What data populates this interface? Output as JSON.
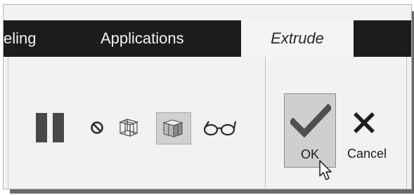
{
  "ribbon": {
    "tabs": [
      {
        "label": "eling",
        "active": false
      },
      {
        "label": "Applications",
        "active": false
      },
      {
        "label": "Extrude",
        "active": true
      }
    ]
  },
  "toolbar": {
    "icons": [
      "pause-icon",
      "no-entry-icon",
      "wireframe-icon",
      "shaded-icon",
      "glasses-icon"
    ],
    "ok_label": "OK",
    "cancel_label": "Cancel"
  },
  "colors": {
    "ribbon_bg": "#1c1c1c",
    "active_tab_bg": "#f4f4f4",
    "panel_bg": "#f2f2f2",
    "ok_check": "#4f4f4f",
    "button_pressed": "#cfcfcf"
  }
}
